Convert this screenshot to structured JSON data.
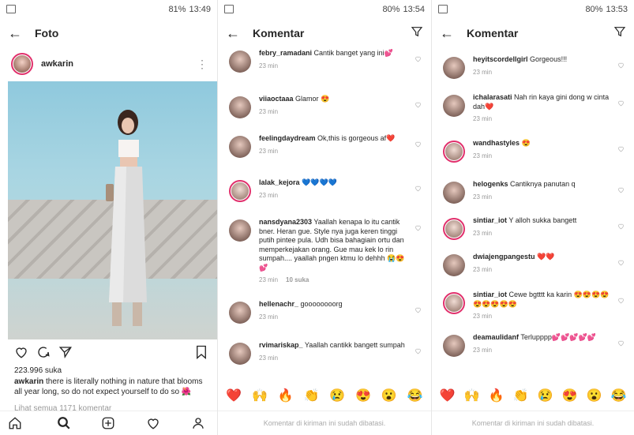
{
  "panel1": {
    "status": {
      "time": "13:49",
      "battery": "81%"
    },
    "title": "Foto",
    "username": "awkarin",
    "likes": "223.996 suka",
    "caption_user": "awkarin",
    "caption_text": "there is literally nothing in nature that blooms all year long, so do not expect yourself to do so",
    "view_all": "Lihat semua 1171 komentar"
  },
  "panel2": {
    "status": {
      "time": "13:54",
      "battery": "80%"
    },
    "title": "Komentar",
    "comments": [
      {
        "user": "febry_ramadani",
        "text": "Cantik banget yang ini💕",
        "time": "23 min",
        "likes": ""
      },
      {
        "user": "viiaoctaaa",
        "text": "Glamor 😍",
        "time": "23 min",
        "likes": ""
      },
      {
        "user": "feelingdaydream",
        "text": "Ok,this is gorgeous af❤️",
        "time": "23 min",
        "likes": ""
      },
      {
        "user": "lalak_kejora",
        "text": "💙💙💙💙",
        "time": "23 min",
        "likes": ""
      },
      {
        "user": "nansdyana2303",
        "text": "Yaallah kenapa lo itu cantik bner. Heran gue. Style nya juga keren tinggi putih pintee pula. Udh bisa bahagiain ortu dan memperkejakan orang. Gue mau kek lo rin sumpah.... yaallah pngen ktmu lo dehhh 😭😍💕",
        "time": "23 min",
        "likes": "10 suka"
      },
      {
        "user": "hellenachr_",
        "text": "goooooooorg",
        "time": "23 min",
        "likes": ""
      },
      {
        "user": "rvimariskap_",
        "text": "Yaallah cantikk bangett sumpah",
        "time": "23 min",
        "likes": ""
      }
    ],
    "disabled_text": "Komentar di kiriman ini sudah dibatasi."
  },
  "panel3": {
    "status": {
      "time": "13:53",
      "battery": "80%"
    },
    "title": "Komentar",
    "comments": [
      {
        "user": "heyitscordellgirl",
        "text": "Gorgeous!!!",
        "time": "23 min",
        "likes": ""
      },
      {
        "user": "ichalarasati",
        "text": "Nah rin kaya gini dong w cinta dah❤️",
        "time": "23 min",
        "likes": ""
      },
      {
        "user": "wandhastyles",
        "text": "😍",
        "time": "23 min",
        "likes": ""
      },
      {
        "user": "helogenks",
        "text": "Cantiknya panutan q",
        "time": "23 min",
        "likes": ""
      },
      {
        "user": "sintiar_iot",
        "text": "Y alloh sukka bangett",
        "time": "23 min",
        "likes": ""
      },
      {
        "user": "dwiajengpangestu",
        "text": "❤️❤️",
        "time": "23 min",
        "likes": ""
      },
      {
        "user": "sintiar_iot",
        "text": "Cewe bgtttt ka karin 😍😍😍😍😍😍😍😍😍",
        "time": "23 min",
        "likes": ""
      },
      {
        "user": "deamaulidanf",
        "text": "Terlupppp💕💕💕💕💕",
        "time": "23 min",
        "likes": ""
      }
    ],
    "disabled_text": "Komentar di kiriman ini sudah dibatasi."
  },
  "emojis": [
    "❤️",
    "🙌",
    "🔥",
    "👏",
    "😢",
    "😍",
    "😮",
    "😂"
  ],
  "icons": {
    "back": "arrow-left-icon",
    "filter": "filter-icon",
    "more": "more-vertical-icon",
    "like": "heart-icon",
    "comment": "comment-icon",
    "share": "send-icon",
    "save": "bookmark-icon",
    "home": "home-icon",
    "search": "search-icon",
    "add": "add-post-icon",
    "activity": "activity-heart-icon",
    "profile": "profile-icon"
  },
  "colors": {
    "accent_heart": "#ed4956",
    "story_ring": "#e1306c",
    "muted_text": "#999999"
  }
}
